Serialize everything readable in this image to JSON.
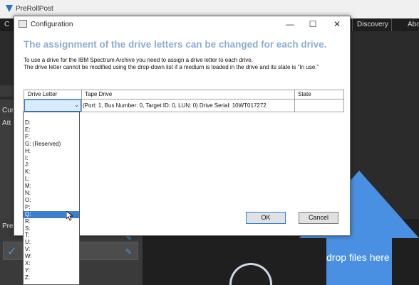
{
  "app": {
    "title": "PreRollPost",
    "menu": {
      "c": "C",
      "discovery": "Discovery",
      "about": "Abo"
    },
    "left_labels": {
      "cur": "Cur",
      "att": "Att",
      "pre": "Pre"
    },
    "drop_text": "drop files here"
  },
  "dialog": {
    "title": "Configuration",
    "heading": "The assignment of the drive letters can be changed for each drive.",
    "desc_line1": "To use a drive for the IBM Spectrum Archive you need to assign a drive letter to each drive.",
    "desc_line2": "The drive letter cannot be modified using the drop-down list if a medium is loaded in the drive and its state is \"In use.\"",
    "columns": {
      "drive_letter": "Drive Letter",
      "tape_drive": "Tape Drive",
      "state": "State"
    },
    "row": {
      "drive_letter": "",
      "tape_drive": "(Port: 1, Bus Number: 0, Target ID: 0, LUN: 0) Drive Serial: 10WT017272",
      "state": ""
    },
    "ok_label": "OK",
    "cancel_label": "Cancel"
  },
  "dropdown": {
    "items": [
      "D:",
      "E:",
      "F:",
      "G: (Reserved)",
      "H:",
      "I:",
      "J:",
      "K:",
      "L:",
      "M:",
      "N:",
      "O:",
      "P:",
      "Q:",
      "R:",
      "S:",
      "T:",
      "U:",
      "V:",
      "W:",
      "X:",
      "Y:",
      "Z:"
    ],
    "selected": "Q:"
  },
  "colors": {
    "heading": "#8aaed4",
    "selection": "#3b7fd0",
    "accent_arrow": "#4a90e2"
  }
}
